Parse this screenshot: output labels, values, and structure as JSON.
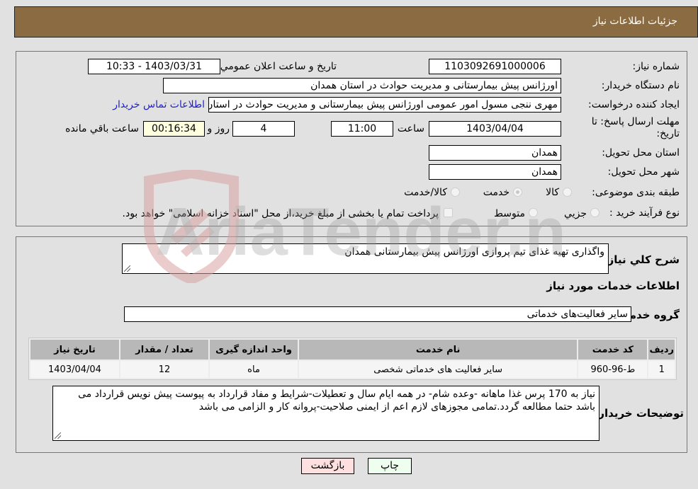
{
  "header": {
    "title": "جزئیات اطلاعات نیاز"
  },
  "form": {
    "need_number": {
      "label": "شماره نیاز:",
      "value": "1103092691000006"
    },
    "announce_datetime": {
      "label": "تاریخ و ساعت اعلان عمومي:",
      "value": "1403/03/31 - 10:33"
    },
    "buyer_org": {
      "label": "نام دستگاه خريدار:",
      "value": "اورژانس پیش بیمارستانی و مدیریت حوادث در استان  همدان"
    },
    "requester": {
      "label": "ايجاد کننده درخواست:",
      "value": "مهری ننجی مسول امور عمومی اورژانس پیش بیمارستانی و مدیریت حوادث در استان همدان",
      "contact_link": "اطلاعات تماس خریدار"
    },
    "deadline": {
      "label_line1": "مهلت ارسال پاسخ: تا",
      "label_line2": "تاریخ:",
      "date": "1403/04/04",
      "time_label": "ساعت",
      "time": "11:00",
      "days": "4",
      "days_label": "روز و",
      "remaining": "00:16:34",
      "remaining_label": "ساعت باقي مانده"
    },
    "delivery_province": {
      "label": "استان محل تحویل:",
      "value": "همدان"
    },
    "delivery_city": {
      "label": "شهر محل تحویل:",
      "value": "همدان"
    },
    "category": {
      "label": "طبقه بندی موضوعی:",
      "options": [
        {
          "label": "کالا",
          "checked": false
        },
        {
          "label": "خدمت",
          "checked": true
        },
        {
          "label": "کالا/خدمت",
          "checked": false
        }
      ]
    },
    "purchase_type": {
      "label": "نوع فرآیند خرید :",
      "options": [
        {
          "label": "جزيي",
          "checked": false
        },
        {
          "label": "متوسط",
          "checked": false
        }
      ],
      "treasury_note": "پرداخت تمام یا بخشی از مبلغ خرید،از محل \"اسناد خزانه اسلامی\" خواهد بود."
    }
  },
  "details": {
    "summary_label": "شرح کلي نياز:",
    "summary_value": "واگذاری تهیه غذای تیم پروازی اورژانس پیش بیمارستانی همدان",
    "services_heading": "اطلاعات خدمات مورد نياز",
    "service_group_label": "گروه خدمت:",
    "service_group_value": "سایر فعالیت‌های خدماتی",
    "table": {
      "headers": [
        "ردیف",
        "کد خدمت",
        "نام خدمت",
        "واحد اندازه گیری",
        "تعداد / مقدار",
        "تاریخ نیاز"
      ],
      "rows": [
        [
          "1",
          "ط-96-960",
          "سایر فعالیت های خدماتی شخصی",
          "ماه",
          "12",
          "1403/04/04"
        ]
      ]
    },
    "buyer_notes_label": "توضيحات خريدار:",
    "buyer_notes_value": "نیاز به 170 پرس غذا ماهانه  -وعده شام- در همه ایام سال و تعطیلات-شرایط و مفاد قرارداد به پیوست پیش نویس قرارداد می باشد حتما مطالعه گردد.تمامی مجوزهای  لازم اعم از ایمنی صلاحیت-پروانه کار و الزامی می باشد"
  },
  "buttons": {
    "print": "چاپ",
    "back": "بازگشت"
  },
  "watermark": {
    "text": "AriaTender.neT"
  }
}
